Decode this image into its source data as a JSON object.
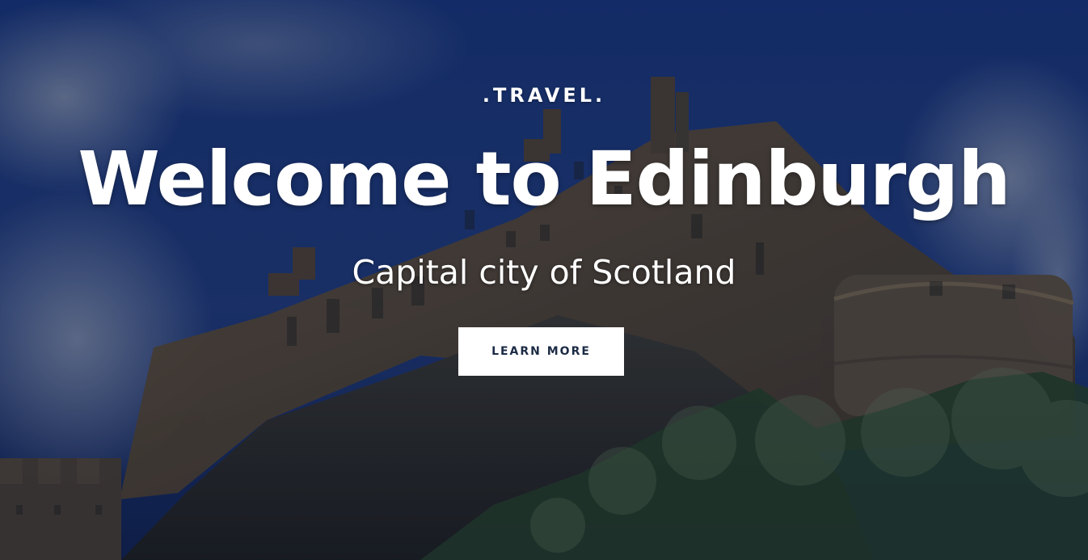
{
  "hero": {
    "eyebrow": ".TRAVEL.",
    "title": "Welcome to Edinburgh",
    "subtitle": "Capital city of Scotland",
    "cta_label": "LEARN MORE"
  },
  "colors": {
    "sky_top": "#1d3d8d",
    "sky_bottom": "#27408a",
    "castle_stone": "#6b5a43",
    "rock": "#2f3133",
    "foliage": "#1d3520",
    "text": "#ffffff",
    "button_background": "#ffffff",
    "button_text": "#1c2b45"
  }
}
